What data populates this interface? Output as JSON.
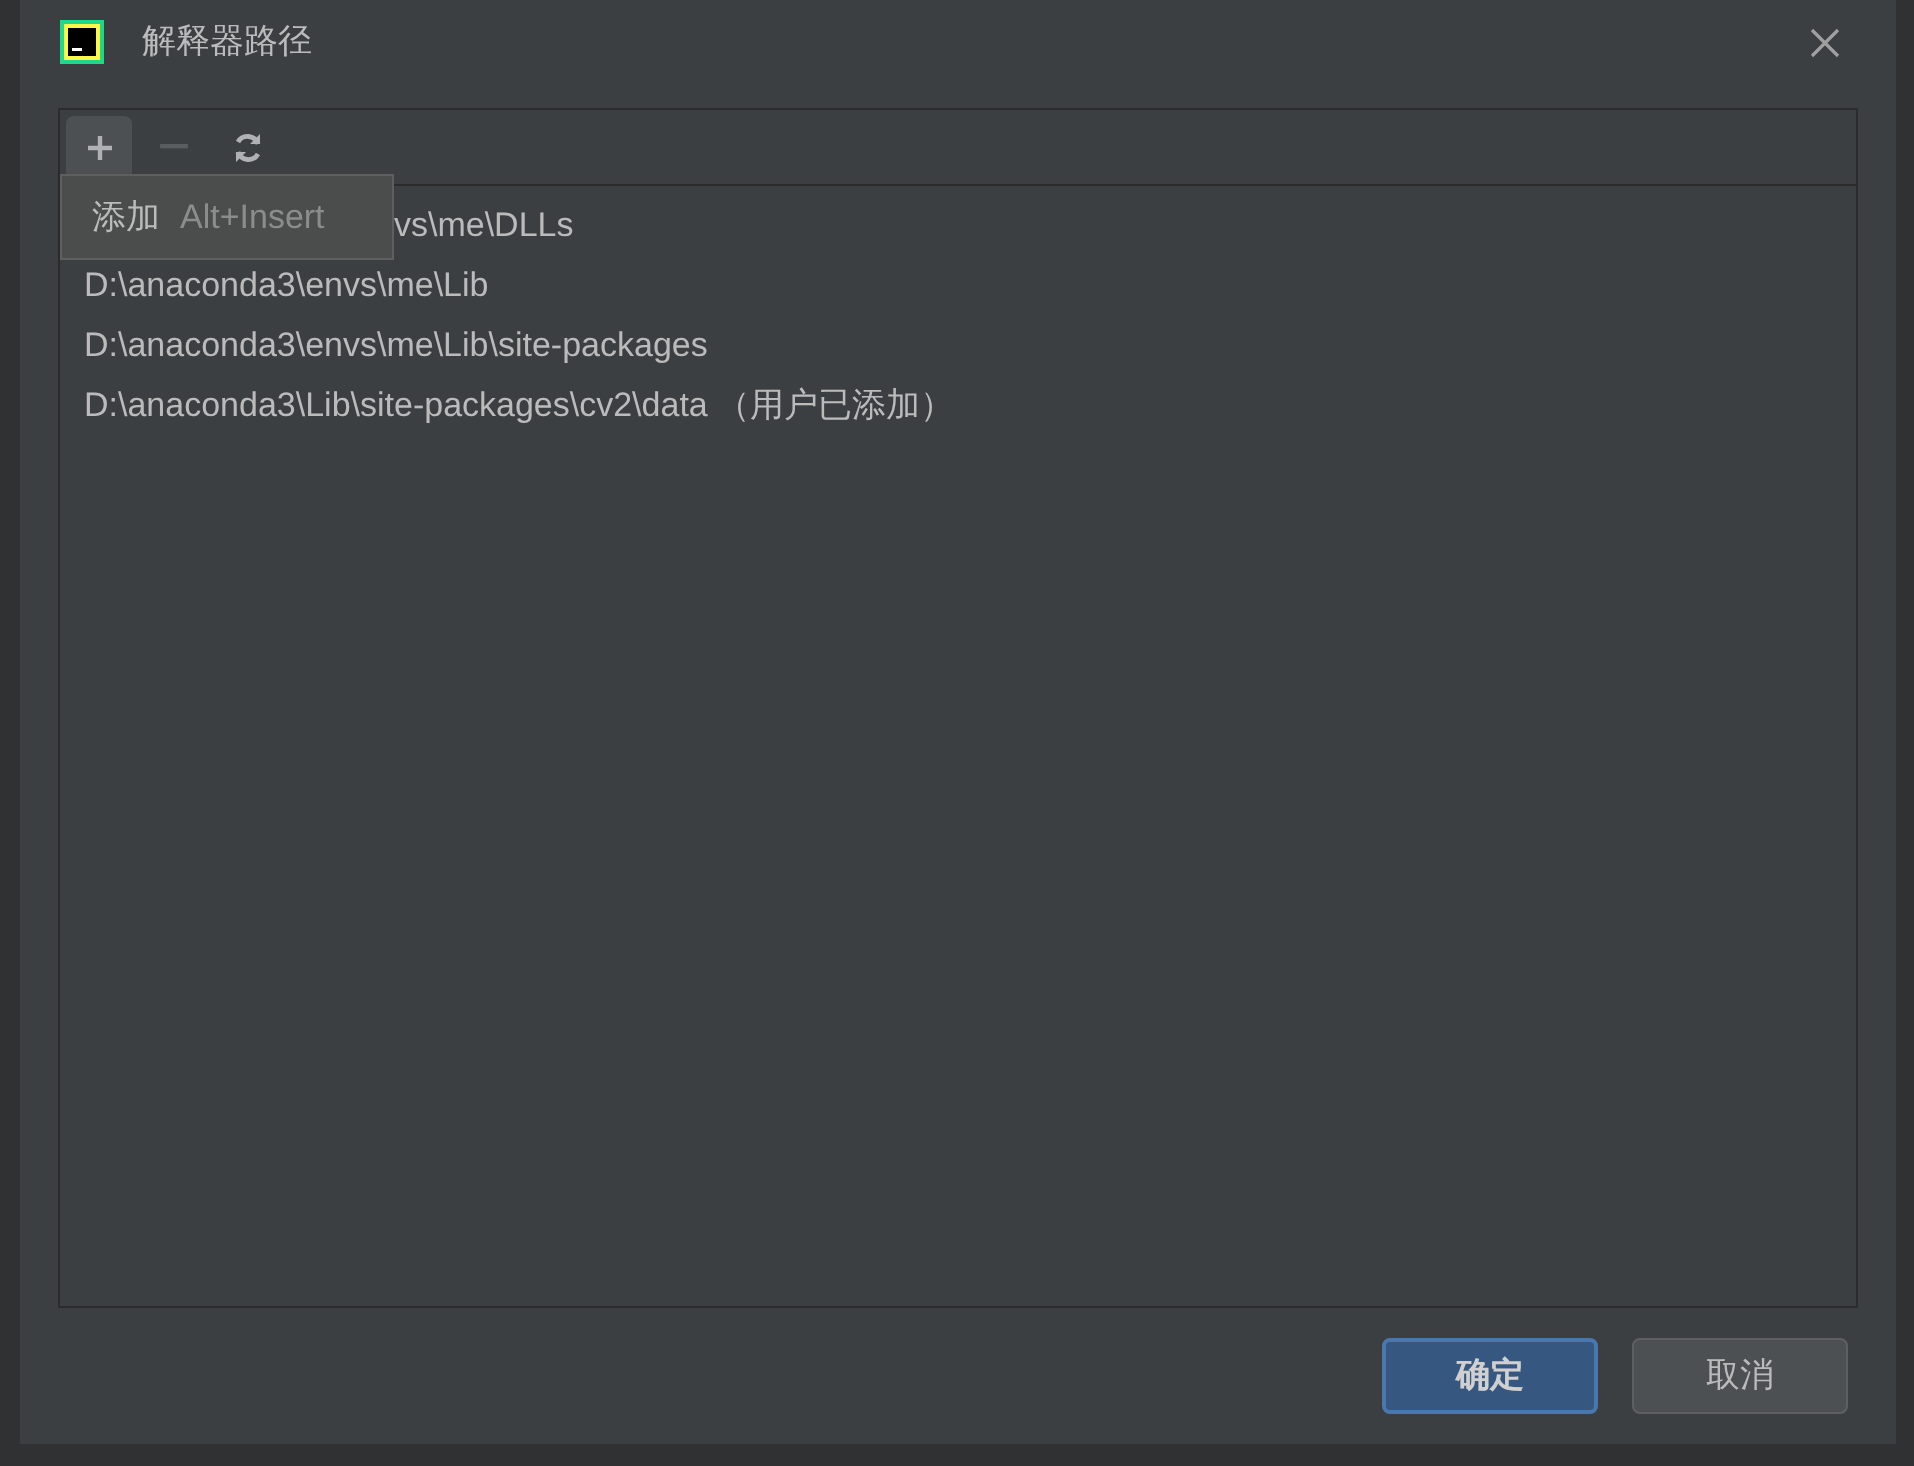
{
  "window": {
    "title": "解释器路径"
  },
  "toolbar": [
    {
      "kind": "add",
      "disabled": false,
      "hovered": true
    },
    {
      "kind": "remove",
      "disabled": true,
      "hovered": false
    },
    {
      "kind": "reload",
      "disabled": false,
      "hovered": false
    }
  ],
  "tooltip": {
    "label": "添加",
    "shortcut": "Alt+Insert"
  },
  "paths": [
    {
      "text": "vs\\me\\DLLs",
      "kind": "partly_covered"
    },
    {
      "text": "D:\\anaconda3\\envs\\me\\Lib",
      "kind": "plain"
    },
    {
      "text": "D:\\anaconda3\\envs\\me\\Lib\\site-packages",
      "kind": "plain"
    },
    {
      "text": "D:\\anaconda3\\Lib\\site-packages\\cv2\\data",
      "kind": "plain",
      "note": "（用户已添加）"
    }
  ],
  "buttons": [
    {
      "label": "确定",
      "default": true
    },
    {
      "label": "取消",
      "default": false
    }
  ]
}
